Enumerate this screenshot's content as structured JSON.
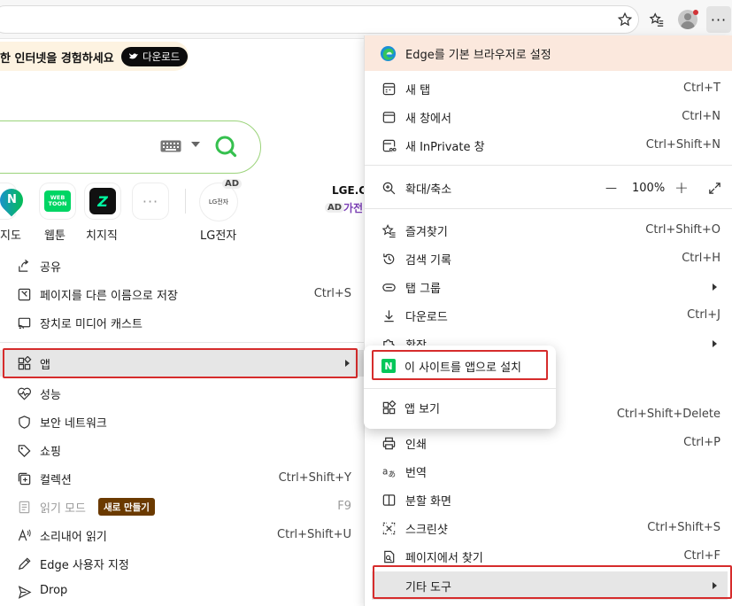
{
  "banner": {
    "text": "한 인터넷을 경험하세요",
    "button_label": "다운로드"
  },
  "shortcuts": [
    {
      "label": "지도",
      "icon": "naver-map-icon"
    },
    {
      "label": "웹툰",
      "icon": "webtoon-icon"
    },
    {
      "label": "치지직",
      "icon": "chzzk-icon"
    },
    {
      "label": "",
      "icon": "more-shortcuts-icon"
    },
    {
      "label": "LG전자",
      "icon": "lg-logo-icon",
      "badge": "AD"
    }
  ],
  "shortcut_icon_text": {
    "naver_map": "N",
    "webtoon": "WEB TOON",
    "chzzk": "Z",
    "lg": "LG전자"
  },
  "ad_tile": {
    "badge": "AD",
    "title": "LGE.CO",
    "ad": "AD",
    "subtitle": "가전"
  },
  "left_menu": {
    "items": [
      {
        "label": "공유",
        "shortcut": "",
        "icon": "share-icon"
      },
      {
        "label": "페이지를 다른 이름으로 저장",
        "shortcut": "Ctrl+S",
        "icon": "save-page-icon"
      },
      {
        "label": "장치로 미디어 캐스트",
        "shortcut": "",
        "icon": "cast-icon"
      },
      {
        "label": "앱",
        "shortcut": "",
        "icon": "apps-icon",
        "submenu": true,
        "highlighted": true
      },
      {
        "label": "성능",
        "shortcut": "",
        "icon": "performance-icon"
      },
      {
        "label": "보안 네트워크",
        "shortcut": "",
        "icon": "shield-icon"
      },
      {
        "label": "쇼핑",
        "shortcut": "",
        "icon": "tag-icon"
      },
      {
        "label": "컬렉션",
        "shortcut": "Ctrl+Shift+Y",
        "icon": "collections-icon"
      },
      {
        "label": "읽기 모드",
        "shortcut": "F9",
        "icon": "reading-mode-icon",
        "disabled": true,
        "badge": "새로 만들기"
      },
      {
        "label": "소리내어 읽기",
        "shortcut": "Ctrl+Shift+U",
        "icon": "read-aloud-icon"
      },
      {
        "label": "Edge 사용자 지정",
        "shortcut": "",
        "icon": "pen-icon"
      },
      {
        "label": "Drop",
        "shortcut": "",
        "icon": "send-icon"
      }
    ]
  },
  "right_menu": {
    "edge_banner": "Edge를 기본 브라우저로 설정",
    "items": [
      {
        "label": "새 탭",
        "shortcut": "Ctrl+T",
        "icon": "new-tab-icon"
      },
      {
        "label": "새 창에서",
        "shortcut": "Ctrl+N",
        "icon": "new-window-icon"
      },
      {
        "label": "새 InPrivate 창",
        "shortcut": "Ctrl+Shift+N",
        "icon": "inprivate-icon"
      },
      {
        "label": "확대/축소",
        "shortcut": "",
        "icon": "zoom-icon"
      },
      {
        "label": "즐겨찾기",
        "shortcut": "Ctrl+Shift+O",
        "icon": "favorites-icon"
      },
      {
        "label": "검색 기록",
        "shortcut": "Ctrl+H",
        "icon": "history-icon"
      },
      {
        "label": "탭 그룹",
        "shortcut": "",
        "icon": "tab-groups-icon",
        "submenu": true
      },
      {
        "label": "다운로드",
        "shortcut": "Ctrl+J",
        "icon": "download-icon"
      },
      {
        "label": "확장",
        "shortcut": "",
        "icon": "extensions-icon",
        "submenu": true
      },
      {
        "label": "",
        "shortcut": "Ctrl+Shift+Delete",
        "icon": ""
      },
      {
        "label": "인쇄",
        "shortcut": "Ctrl+P",
        "icon": "print-icon"
      },
      {
        "label": "번역",
        "shortcut": "",
        "icon": "translate-icon"
      },
      {
        "label": "분할 화면",
        "shortcut": "",
        "icon": "split-screen-icon"
      },
      {
        "label": "스크린샷",
        "shortcut": "Ctrl+Shift+S",
        "icon": "screenshot-icon"
      },
      {
        "label": "페이지에서 찾기",
        "shortcut": "Ctrl+F",
        "icon": "find-icon"
      },
      {
        "label": "기타 도구",
        "shortcut": "",
        "icon": "",
        "submenu": true,
        "highlighted": true
      }
    ],
    "zoom": {
      "minus": "—",
      "value": "100%",
      "plus": "+"
    }
  },
  "apps_flyout": {
    "items": [
      {
        "label": "이 사이트를 앱으로 설치",
        "icon": "naver-n-icon",
        "icon_text": "N"
      },
      {
        "label": "앱 보기",
        "icon": "apps-icon"
      }
    ]
  },
  "toolbar": {
    "more_label": "···"
  },
  "colors": {
    "highlight": "#e6e6e6",
    "red_outline": "#d62c2c",
    "search_border": "#9bd37a",
    "new_badge": "#6b3a00",
    "edge_banner": "#fbe8dd",
    "naver_green": "#03c75a"
  }
}
